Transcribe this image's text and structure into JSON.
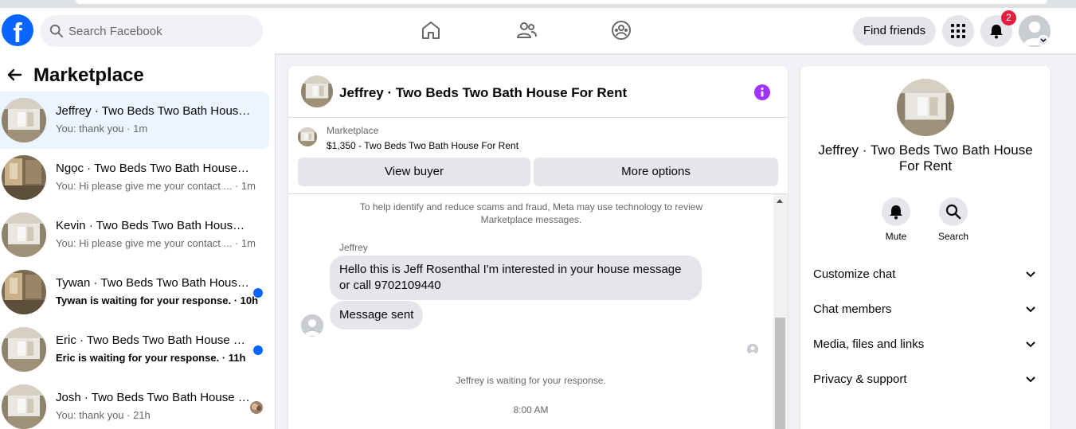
{
  "topbar": {
    "logo": "f",
    "search_placeholder": "Search Facebook",
    "find_friends_label": "Find friends",
    "notification_count": "2",
    "nav_icons": [
      "home-icon",
      "friends-icon",
      "groups-icon"
    ]
  },
  "sidebar": {
    "title": "Marketplace",
    "conversations": [
      {
        "name": "Jeffrey · Two Beds Two Bath House For Rent",
        "preview": "You: thank you · 1m",
        "unread": false,
        "active": true
      },
      {
        "name": "Ngọc · Two Beds Two Bath House For Rent",
        "preview": "You: Hi please give me your contact ...  · 1m",
        "unread": false,
        "active": false
      },
      {
        "name": "Kevin · Two Beds Two Bath House For Rent",
        "preview": "You: Hi please give me your contact ...  · 1m",
        "unread": false,
        "active": false
      },
      {
        "name": "Tywan · Two Beds Two Bath House For Rent",
        "preview": "Tywan is waiting for your response. · 10h",
        "unread": true,
        "active": false
      },
      {
        "name": "Eric · Two Beds Two Bath House For Rent",
        "preview": "Eric is waiting for your response. · 11h",
        "unread": true,
        "active": false
      },
      {
        "name": "Josh · Two Beds Two Bath House For Rent",
        "preview": "You: thank you · 21h",
        "unread": false,
        "active": false
      }
    ]
  },
  "chat": {
    "title": "Jeffrey · Two Beds Two Bath House For Rent",
    "listing_label": "Marketplace",
    "listing_price": "$1,350 - Two Beds Two Bath House For Rent",
    "view_buyer_label": "View buyer",
    "more_options_label": "More options",
    "notice": "To help identify and reduce scams and fraud, Meta may use technology to review Marketplace messages.",
    "sender_name": "Jeffrey",
    "messages": [
      "Hello this is Jeff Rosenthal I'm interested in your house message or call 9702109440",
      "Message sent"
    ],
    "waiting_text": "Jeffrey is waiting for your response.",
    "timestamp": "8:00 AM"
  },
  "info_panel": {
    "title": "Jeffrey · Two Beds Two Bath House For Rent",
    "mute_label": "Mute",
    "search_label": "Search",
    "sections": [
      "Customize chat",
      "Chat members",
      "Media, files and links",
      "Privacy & support"
    ]
  },
  "colors": {
    "brand_blue": "#0866ff",
    "badge_red": "#e41e3f",
    "info_purple": "#a033ff",
    "active_bg": "#ebf5ff"
  }
}
